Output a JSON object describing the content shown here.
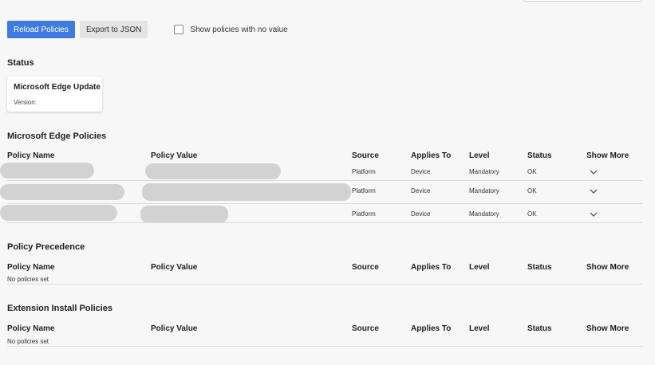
{
  "toolbar": {
    "reload_label": "Reload Policies",
    "export_label": "Export to JSON",
    "show_empty_label": "Show policies with no value",
    "show_empty_checked": false
  },
  "status_section": {
    "heading": "Status",
    "card_title": "Microsoft Edge Update",
    "card_version_label": "Version:"
  },
  "columns": {
    "policy_name": "Policy Name",
    "policy_value": "Policy Value",
    "source": "Source",
    "applies_to": "Applies To",
    "level": "Level",
    "status": "Status",
    "show_more": "Show More"
  },
  "edge_policies": {
    "heading": "Microsoft Edge Policies",
    "rows": [
      {
        "source": "Platform",
        "applies_to": "Device",
        "level": "Mandatory",
        "status": "OK",
        "icon": "chevron-down-icon"
      },
      {
        "source": "Platform",
        "applies_to": "Device",
        "level": "Mandatory",
        "status": "OK",
        "icon": "chevron-down-icon"
      },
      {
        "source": "Platform",
        "applies_to": "Device",
        "level": "Mandatory",
        "status": "OK",
        "icon": "chevron-down-icon"
      }
    ]
  },
  "precedence": {
    "heading": "Policy Precedence",
    "empty_text": "No policies set"
  },
  "extension_install": {
    "heading": "Extension Install Policies",
    "empty_text": "No policies set"
  },
  "colors": {
    "primary_button": "#3d7be0",
    "secondary_button": "#e4e4e4",
    "background": "#f7f7f7",
    "redaction": "#d2d2d2"
  }
}
